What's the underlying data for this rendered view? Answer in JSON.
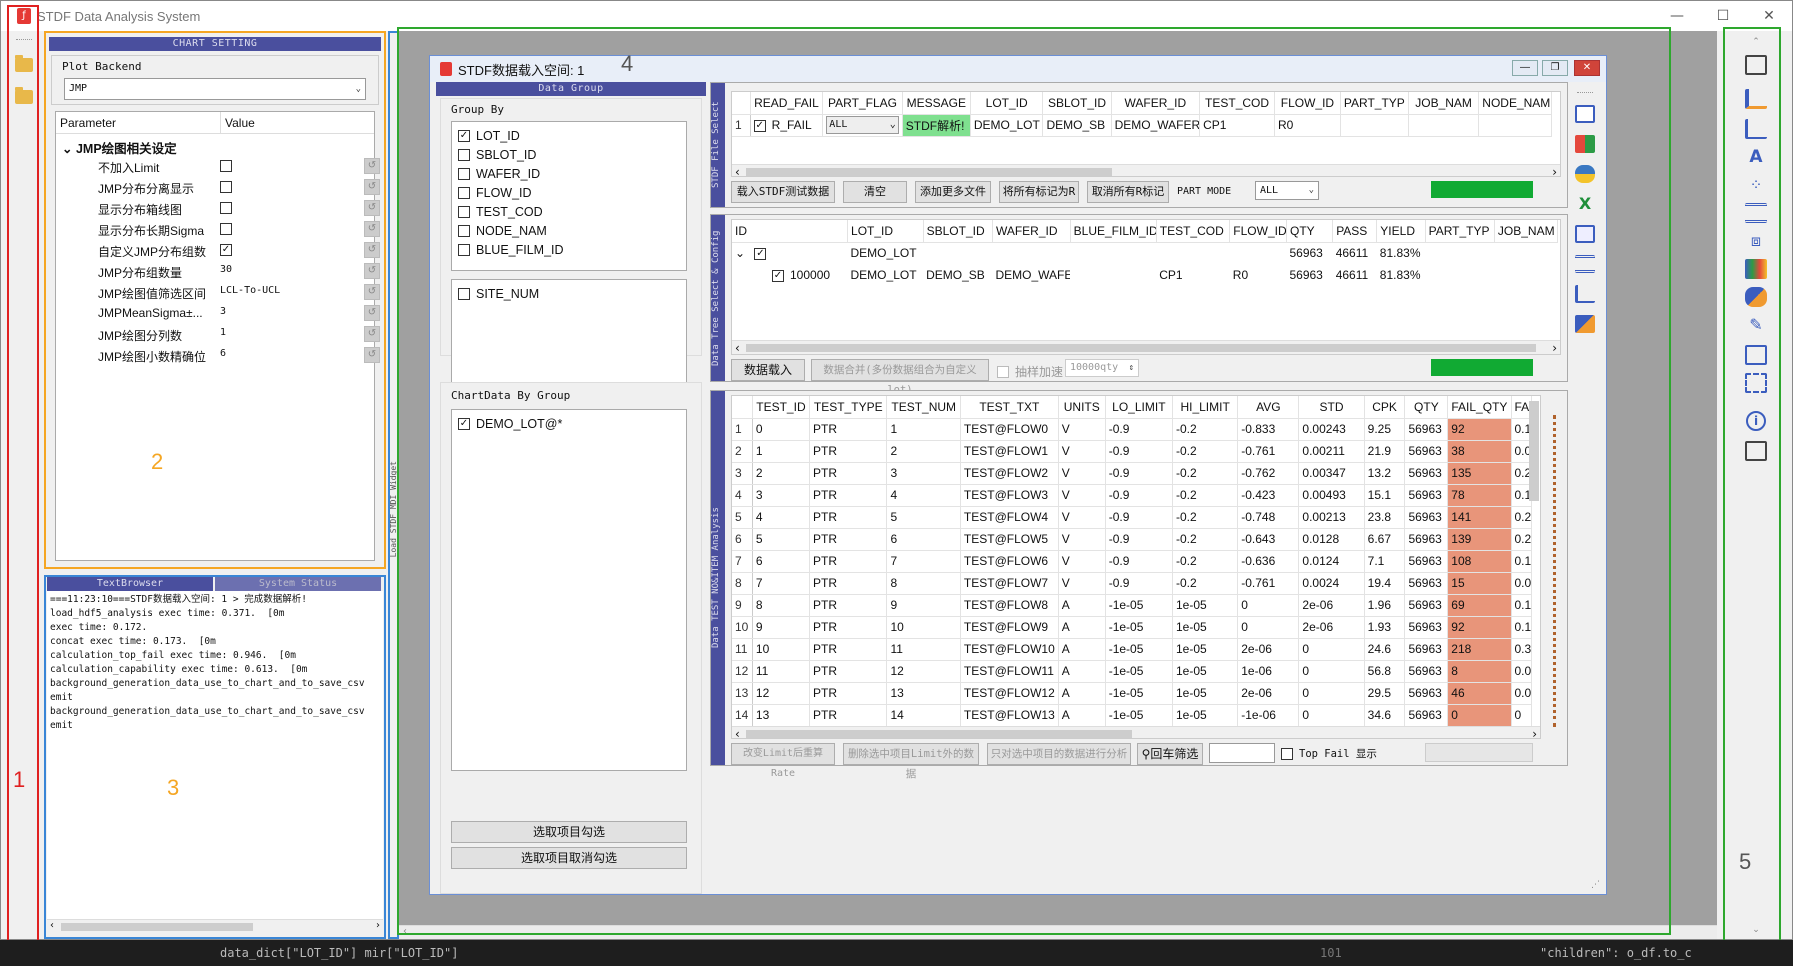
{
  "app": {
    "title": "STDF Data Analysis System",
    "window_controls": [
      "—",
      "☐",
      "✕"
    ]
  },
  "annotations": {
    "n1": "1",
    "n2": "2",
    "n3": "3",
    "n4": "4",
    "n5": "5"
  },
  "chart_setting": {
    "header": "CHART SETTING",
    "plot_backend_label": "Plot Backend",
    "plot_backend_value": "JMP",
    "col_param": "Parameter",
    "col_value": "Value",
    "group_title": "JMP绘图相关设定",
    "params": [
      {
        "name": "不加入Limit",
        "type": "check",
        "value": ""
      },
      {
        "name": "JMP分布分离显示",
        "type": "check",
        "value": ""
      },
      {
        "name": "显示分布箱线图",
        "type": "check",
        "value": ""
      },
      {
        "name": "显示分布长期Sigma",
        "type": "check",
        "value": ""
      },
      {
        "name": "自定义JMP分布组数",
        "type": "check",
        "value": "✓"
      },
      {
        "name": "JMP分布组数量",
        "type": "text",
        "value": "30"
      },
      {
        "name": "JMP绘图值筛选区间",
        "type": "text",
        "value": "LCL-To-UCL"
      },
      {
        "name": "JMPMeanSigma±...",
        "type": "text",
        "value": "3"
      },
      {
        "name": "JMP绘图分列数",
        "type": "text",
        "value": "1"
      },
      {
        "name": "JMP绘图小数精确位",
        "type": "text",
        "value": "6"
      }
    ]
  },
  "text_browser": {
    "tab_active": "TextBrowser",
    "tab_inactive": "System Status",
    "log": "===11:23:10===STDF数据载入空间: 1 > 完成数据解析!\nload_hdf5_analysis exec time: 0.371.  [0m\nexec time: 0.172.\nconcat exec time: 0.173.  [0m\ncalculation_top_fail exec time: 0.946.  [0m\ncalculation_capability exec time: 0.613.  [0m\nbackground_generation_data_use_to_chart_and_to_save_csv\nemit\nbackground_generation_data_use_to_chart_and_to_save_csv\nemit"
  },
  "splitter_label": "Load STDF MDI Widget",
  "subwindow": {
    "title": "STDF数据载入空间: 1",
    "data_group_header": "Data Group",
    "group_by_label": "Group By",
    "group_by_items": [
      {
        "label": "LOT_ID",
        "checked": "✓"
      },
      {
        "label": "SBLOT_ID",
        "checked": ""
      },
      {
        "label": "WAFER_ID",
        "checked": ""
      },
      {
        "label": "FLOW_ID",
        "checked": ""
      },
      {
        "label": "TEST_COD",
        "checked": ""
      },
      {
        "label": "NODE_NAM",
        "checked": ""
      },
      {
        "label": "BLUE_FILM_ID",
        "checked": ""
      }
    ],
    "site_item": {
      "label": "SITE_NUM",
      "checked": ""
    },
    "chartdata_label": "ChartData By Group",
    "chartdata_items": [
      {
        "label": "DEMO_LOT@*",
        "checked": "✓"
      }
    ],
    "btn_select": "选取项目勾选",
    "btn_unselect": "选取项目取消勾选"
  },
  "file_select": {
    "vlabel": "STDF File Select",
    "headers": [
      "",
      "READ_FAIL",
      "PART_FLAG",
      "MESSAGE",
      "LOT_ID",
      "SBLOT_ID",
      "WAFER_ID",
      "TEST_COD",
      "FLOW_ID",
      "PART_TYP",
      "JOB_NAM",
      "NODE_NAM"
    ],
    "row": {
      "index": "1",
      "read_fail": "R_FAIL",
      "read_fail_checked": "✓",
      "part_flag": "ALL",
      "message": "STDF解析!",
      "lot_id": "DEMO_LOT",
      "sblot_id": "DEMO_SB",
      "wafer_id": "DEMO_WAFER",
      "test_cod": "CP1",
      "flow_id": "R0"
    },
    "btn_load": "载入STDF测试数据",
    "btn_clear": "清空",
    "btn_add": "添加更多文件",
    "btn_mark": "将所有标记为R",
    "btn_unmark": "取消所有R标记",
    "part_mode_label": "PART  MODE",
    "part_mode_value": "ALL"
  },
  "tree_select": {
    "vlabel": "Data Tree Select & Config",
    "headers": [
      "ID",
      "LOT_ID",
      "SBLOT_ID",
      "WAFER_ID",
      "BLUE_FILM_ID",
      "TEST_COD",
      "FLOW_ID",
      "QTY",
      "PASS",
      "YIELD",
      "PART_TYP",
      "JOB_NAM"
    ],
    "parent": {
      "lot_id": "DEMO_LOT",
      "qty": "56963",
      "pass": "46611",
      "yield": "81.83%"
    },
    "child": {
      "id": "100000",
      "lot_id": "DEMO_LOT",
      "sblot_id": "DEMO_SB",
      "wafer_id": "DEMO_WAFER",
      "test_cod": "CP1",
      "flow_id": "R0",
      "qty": "56963",
      "pass": "46611",
      "yield": "81.83%"
    },
    "btn_load": "数据载入",
    "btn_merge": "数据合并(多份数据组合为自定义lot)",
    "sample_label": "抽样加速",
    "sample_value": "10000qty"
  },
  "analysis": {
    "vlabel": "Data TEST NO&ITEM Analysis",
    "headers": [
      "",
      "TEST_ID",
      "TEST_TYPE",
      "TEST_NUM",
      "TEST_TXT",
      "UNITS",
      "LO_LIMIT",
      "HI_LIMIT",
      "AVG",
      "STD",
      "CPK",
      "QTY",
      "FAIL_QTY",
      "FA"
    ],
    "rows": [
      [
        "1",
        "0",
        "PTR",
        "1",
        "TEST@FLOW0",
        "V",
        "-0.9",
        "-0.2",
        "-0.833",
        "0.00243",
        "9.25",
        "56963",
        "92",
        "0.1"
      ],
      [
        "2",
        "1",
        "PTR",
        "2",
        "TEST@FLOW1",
        "V",
        "-0.9",
        "-0.2",
        "-0.761",
        "0.00211",
        "21.9",
        "56963",
        "38",
        "0.0"
      ],
      [
        "3",
        "2",
        "PTR",
        "3",
        "TEST@FLOW2",
        "V",
        "-0.9",
        "-0.2",
        "-0.762",
        "0.00347",
        "13.2",
        "56963",
        "135",
        "0.2"
      ],
      [
        "4",
        "3",
        "PTR",
        "4",
        "TEST@FLOW3",
        "V",
        "-0.9",
        "-0.2",
        "-0.423",
        "0.00493",
        "15.1",
        "56963",
        "78",
        "0.1"
      ],
      [
        "5",
        "4",
        "PTR",
        "5",
        "TEST@FLOW4",
        "V",
        "-0.9",
        "-0.2",
        "-0.748",
        "0.00213",
        "23.8",
        "56963",
        "141",
        "0.2"
      ],
      [
        "6",
        "5",
        "PTR",
        "6",
        "TEST@FLOW5",
        "V",
        "-0.9",
        "-0.2",
        "-0.643",
        "0.0128",
        "6.67",
        "56963",
        "139",
        "0.2"
      ],
      [
        "7",
        "6",
        "PTR",
        "7",
        "TEST@FLOW6",
        "V",
        "-0.9",
        "-0.2",
        "-0.636",
        "0.0124",
        "7.1",
        "56963",
        "108",
        "0.1"
      ],
      [
        "8",
        "7",
        "PTR",
        "8",
        "TEST@FLOW7",
        "V",
        "-0.9",
        "-0.2",
        "-0.761",
        "0.0024",
        "19.4",
        "56963",
        "15",
        "0.0"
      ],
      [
        "9",
        "8",
        "PTR",
        "9",
        "TEST@FLOW8",
        "A",
        "-1e-05",
        "1e-05",
        "0",
        "2e-06",
        "1.96",
        "56963",
        "69",
        "0.1"
      ],
      [
        "10",
        "9",
        "PTR",
        "10",
        "TEST@FLOW9",
        "A",
        "-1e-05",
        "1e-05",
        "0",
        "2e-06",
        "1.93",
        "56963",
        "92",
        "0.1"
      ],
      [
        "11",
        "10",
        "PTR",
        "11",
        "TEST@FLOW10",
        "A",
        "-1e-05",
        "1e-05",
        "2e-06",
        "0",
        "24.6",
        "56963",
        "218",
        "0.3"
      ],
      [
        "12",
        "11",
        "PTR",
        "12",
        "TEST@FLOW11",
        "A",
        "-1e-05",
        "1e-05",
        "1e-06",
        "0",
        "56.8",
        "56963",
        "8",
        "0.0"
      ],
      [
        "13",
        "12",
        "PTR",
        "13",
        "TEST@FLOW12",
        "A",
        "-1e-05",
        "1e-05",
        "2e-06",
        "0",
        "29.5",
        "56963",
        "46",
        "0.0"
      ],
      [
        "14",
        "13",
        "PTR",
        "14",
        "TEST@FLOW13",
        "A",
        "-1e-05",
        "1e-05",
        "-1e-06",
        "0",
        "34.6",
        "56963",
        "0",
        "0"
      ]
    ],
    "btn_recalc": "改变Limit后重算Rate",
    "btn_delete": "删除选中项目Limit外的数据",
    "btn_only": "只对选中项目的数据进行分析",
    "btn_filter": "回车筛选",
    "topfail_label": "Top Fail 显示"
  },
  "bottom_code": {
    "left": "data_dict[\"LOT_ID\"]   mir[\"LOT_ID\"]",
    "mid": "101",
    "right": "\"children\": o_df.to_c"
  },
  "colors": {
    "accent": "#4a4f9e",
    "fail_cell": "#e8957a",
    "green": "#11aa33",
    "annot_red": "#e02020",
    "annot_orange": "#f5a623",
    "annot_blue": "#3a86d6",
    "annot_green": "#2ea82e"
  }
}
